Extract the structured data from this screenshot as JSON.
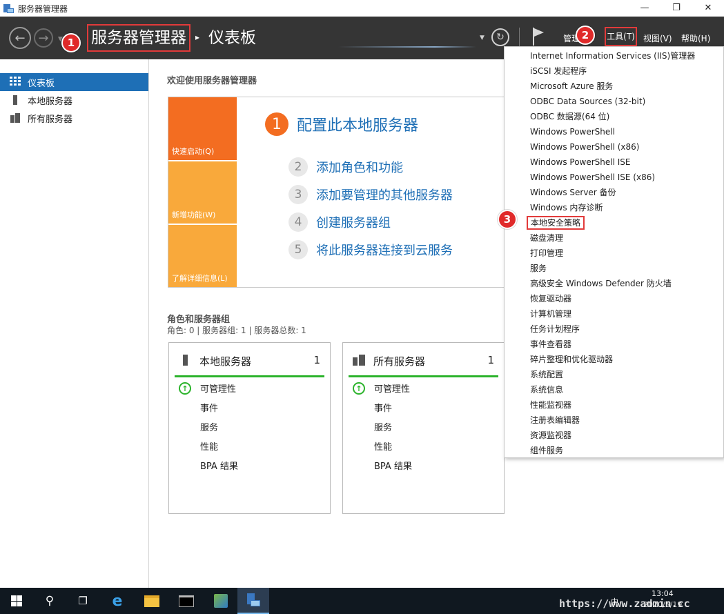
{
  "window": {
    "title": "服务器管理器",
    "controls": [
      "—",
      "❐",
      "✕"
    ]
  },
  "header": {
    "breadcrumb_root": "服务器管理器",
    "breadcrumb_sep": "▸",
    "breadcrumb_page": "仪表板",
    "menus": {
      "manage": "管理",
      "tools": "工具(T)",
      "view": "视图(V)",
      "help": "帮助(H)"
    }
  },
  "callouts": [
    "1",
    "2",
    "3"
  ],
  "sidebar": {
    "items": [
      {
        "label": "仪表板",
        "active": true
      },
      {
        "label": "本地服务器",
        "active": false
      },
      {
        "label": "所有服务器",
        "active": false
      }
    ]
  },
  "main": {
    "welcome_title": "欢迎使用服务器管理器",
    "tiles": [
      "快速启动(Q)",
      "新增功能(W)",
      "了解详细信息(L)"
    ],
    "steps": [
      {
        "num": "1",
        "label": "配置此本地服务器"
      },
      {
        "num": "2",
        "label": "添加角色和功能"
      },
      {
        "num": "3",
        "label": "添加要管理的其他服务器"
      },
      {
        "num": "4",
        "label": "创建服务器组"
      },
      {
        "num": "5",
        "label": "将此服务器连接到云服务"
      }
    ],
    "roles_title": "角色和服务器组",
    "roles_subtitle": "角色: 0 | 服务器组: 1 | 服务器总数: 1",
    "cards": [
      {
        "name": "本地服务器",
        "count": "1",
        "rows": [
          "可管理性",
          "事件",
          "服务",
          "性能",
          "BPA 结果"
        ]
      },
      {
        "name": "所有服务器",
        "count": "1",
        "rows": [
          "可管理性",
          "事件",
          "服务",
          "性能",
          "BPA 结果"
        ]
      }
    ]
  },
  "tools_menu": {
    "items": [
      "Internet Information Services (IIS)管理器",
      "iSCSI 发起程序",
      "Microsoft Azure 服务",
      "ODBC Data Sources (32-bit)",
      "ODBC 数据源(64 位)",
      "Windows PowerShell",
      "Windows PowerShell (x86)",
      "Windows PowerShell ISE",
      "Windows PowerShell ISE (x86)",
      "Windows Server 备份",
      "Windows 内存诊断",
      "本地安全策略",
      "磁盘清理",
      "打印管理",
      "服务",
      "高级安全 Windows Defender 防火墙",
      "恢复驱动器",
      "计算机管理",
      "任务计划程序",
      "事件查看器",
      "碎片整理和优化驱动器",
      "系统配置",
      "系统信息",
      "性能监视器",
      "注册表编辑器",
      "资源监视器",
      "组件服务"
    ],
    "highlighted": "本地安全策略"
  },
  "taskbar": {
    "clock_time": "13:04",
    "clock_date": "2020/5/19",
    "tray_label": "中",
    "watermark": "https://www.zadmin.cc"
  },
  "colors": {
    "accent": "#1e6fb6",
    "orange": "#f36d21",
    "light_orange": "#f9a93b",
    "callout_red": "#e02a2a",
    "status_green": "#2bb32b",
    "header_bg": "#353535"
  }
}
